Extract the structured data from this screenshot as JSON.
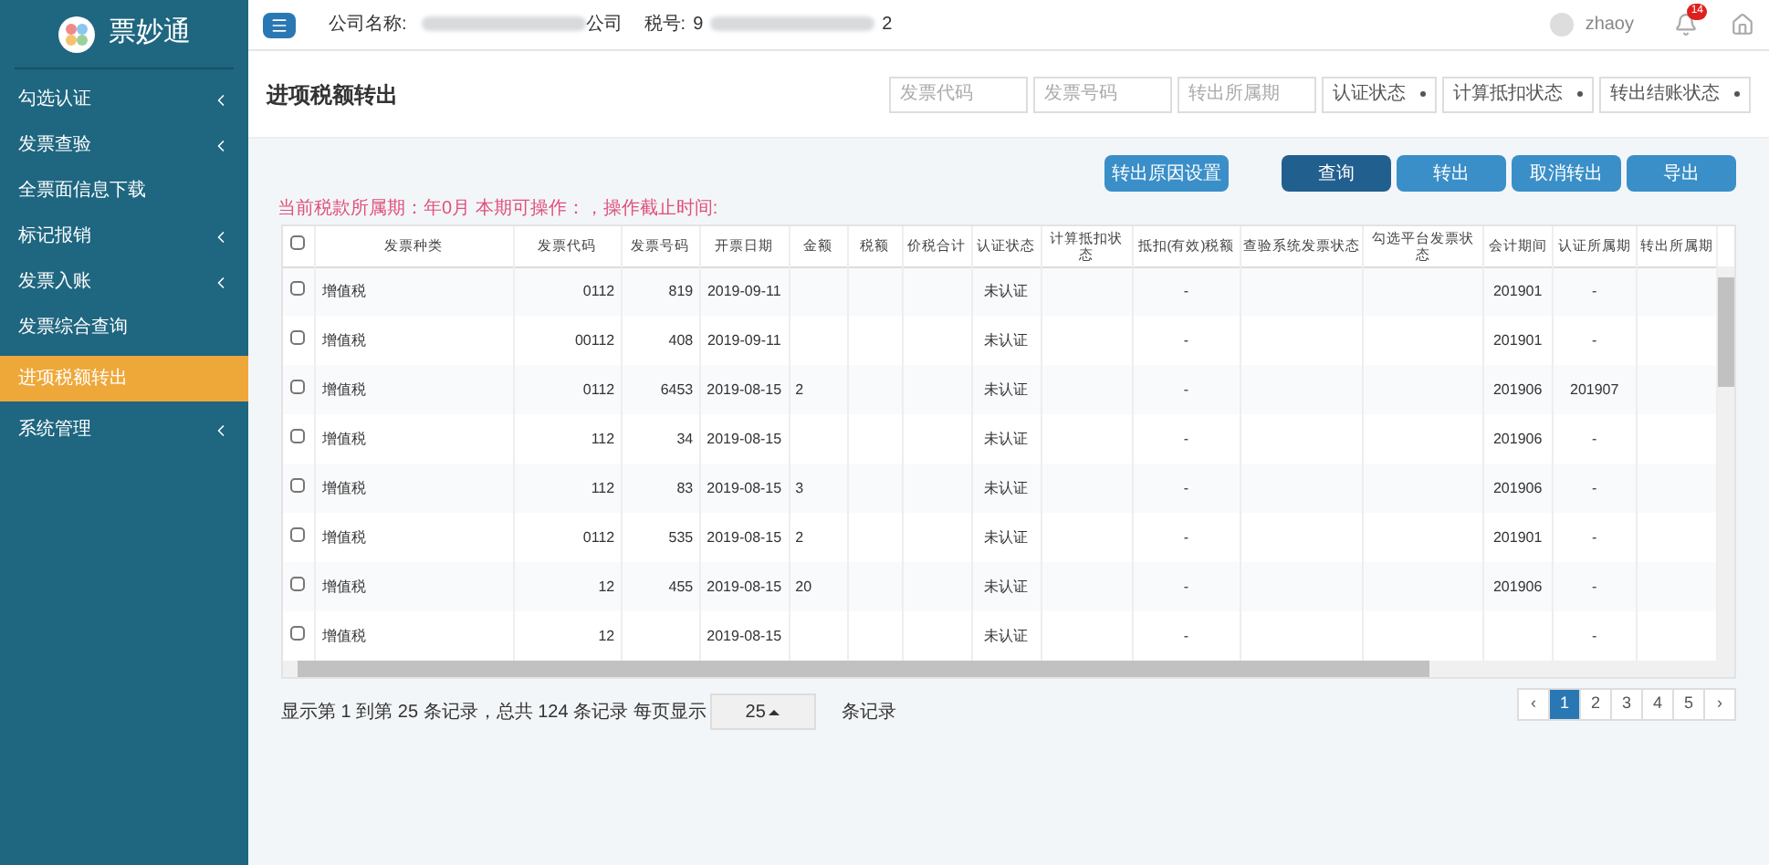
{
  "brand": {
    "name": "票妙通"
  },
  "sidebar": {
    "items": [
      {
        "label": "勾选认证",
        "expandable": true,
        "selected": false
      },
      {
        "label": "发票查验",
        "expandable": true,
        "selected": false
      },
      {
        "label": "全票面信息下载",
        "expandable": false,
        "selected": false
      },
      {
        "label": "标记报销",
        "expandable": true,
        "selected": false
      },
      {
        "label": "发票入账",
        "expandable": true,
        "selected": false
      },
      {
        "label": "发票综合查询",
        "expandable": false,
        "selected": false
      },
      {
        "label": "进项税额转出",
        "expandable": false,
        "selected": true
      },
      {
        "label": "系统管理",
        "expandable": true,
        "selected": false
      }
    ]
  },
  "header": {
    "company_label": "公司名称:",
    "company_value": "公司",
    "tax_label": "税号:",
    "tax_value_start": "9",
    "tax_value_end": "2",
    "user": "zhaoy",
    "notification_badge": "14"
  },
  "page_title": "进项税额转出",
  "filters": [
    {
      "kind": "input",
      "placeholder": "发票代码"
    },
    {
      "kind": "input",
      "placeholder": "发票号码"
    },
    {
      "kind": "input",
      "placeholder": "转出所属期"
    },
    {
      "kind": "select",
      "value": "认证状态"
    },
    {
      "kind": "select",
      "value": "计算抵扣状态"
    },
    {
      "kind": "select",
      "value": "转出结账状态"
    }
  ],
  "buttons": [
    {
      "label": "转出原因设置",
      "selected": false
    },
    {
      "label": "查询",
      "selected": true
    },
    {
      "label": "转出",
      "selected": false
    },
    {
      "label": "取消转出",
      "selected": false
    },
    {
      "label": "导出",
      "selected": false
    }
  ],
  "notice": "当前税款所属期：年0月 本期可操作：，操作截止时间:",
  "table": {
    "select_all_checked": false,
    "columns": [
      "发票种类",
      "发票代码",
      "发票号码",
      "开票日期",
      "金额",
      "税额",
      "价税合计",
      "认证状态",
      "计算抵扣状态",
      "抵扣(有效)税额",
      "查验系统发票状态",
      "勾选平台发票状态",
      "会计期间",
      "认证所属期",
      "转出所属期"
    ],
    "rows": [
      {
        "checked": false,
        "cells": [
          "增值税",
          "0112",
          "819",
          "2019-09-11",
          "",
          "",
          "",
          "未认证",
          "",
          "-",
          "",
          "",
          "201901",
          "-",
          ""
        ]
      },
      {
        "checked": false,
        "cells": [
          "增值税",
          "00112",
          "408",
          "2019-09-11",
          "",
          "",
          "",
          "未认证",
          "",
          "-",
          "",
          "",
          "201901",
          "-",
          ""
        ]
      },
      {
        "checked": false,
        "cells": [
          "增值税",
          "0112",
          "6453",
          "2019-08-15",
          "2",
          "",
          "",
          "未认证",
          "",
          "-",
          "",
          "",
          "201906",
          "201907",
          ""
        ]
      },
      {
        "checked": false,
        "cells": [
          "增值税",
          "112",
          "34",
          "2019-08-15",
          "",
          "",
          "",
          "未认证",
          "",
          "-",
          "",
          "",
          "201906",
          "-",
          ""
        ]
      },
      {
        "checked": false,
        "cells": [
          "增值税",
          "112",
          "83",
          "2019-08-15",
          "3",
          "",
          "",
          "未认证",
          "",
          "-",
          "",
          "",
          "201906",
          "-",
          ""
        ]
      },
      {
        "checked": false,
        "cells": [
          "增值税",
          "0112",
          "535",
          "2019-08-15",
          "2",
          "",
          "",
          "未认证",
          "",
          "-",
          "",
          "",
          "201901",
          "-",
          ""
        ]
      },
      {
        "checked": false,
        "cells": [
          "增值税",
          "12",
          "455",
          "2019-08-15",
          "20",
          "",
          "",
          "未认证",
          "",
          "-",
          "",
          "",
          "201906",
          "-",
          ""
        ]
      },
      {
        "checked": false,
        "cells": [
          "增值税",
          "12",
          "",
          "2019-08-15",
          "",
          "",
          "",
          "未认证",
          "",
          "-",
          "",
          "",
          "",
          "-",
          ""
        ]
      }
    ]
  },
  "footer": {
    "summary": "显示第 1 到第 25 条记录，总共 124 条记录 每页显示",
    "page_size": "25",
    "page_size_suffix": "条记录"
  },
  "pagination": [
    {
      "label": "‹",
      "selected": false
    },
    {
      "label": "1",
      "selected": true
    },
    {
      "label": "2",
      "selected": false
    },
    {
      "label": "3",
      "selected": false
    },
    {
      "label": "4",
      "selected": false
    },
    {
      "label": "5",
      "selected": false
    },
    {
      "label": "›",
      "selected": false
    }
  ]
}
